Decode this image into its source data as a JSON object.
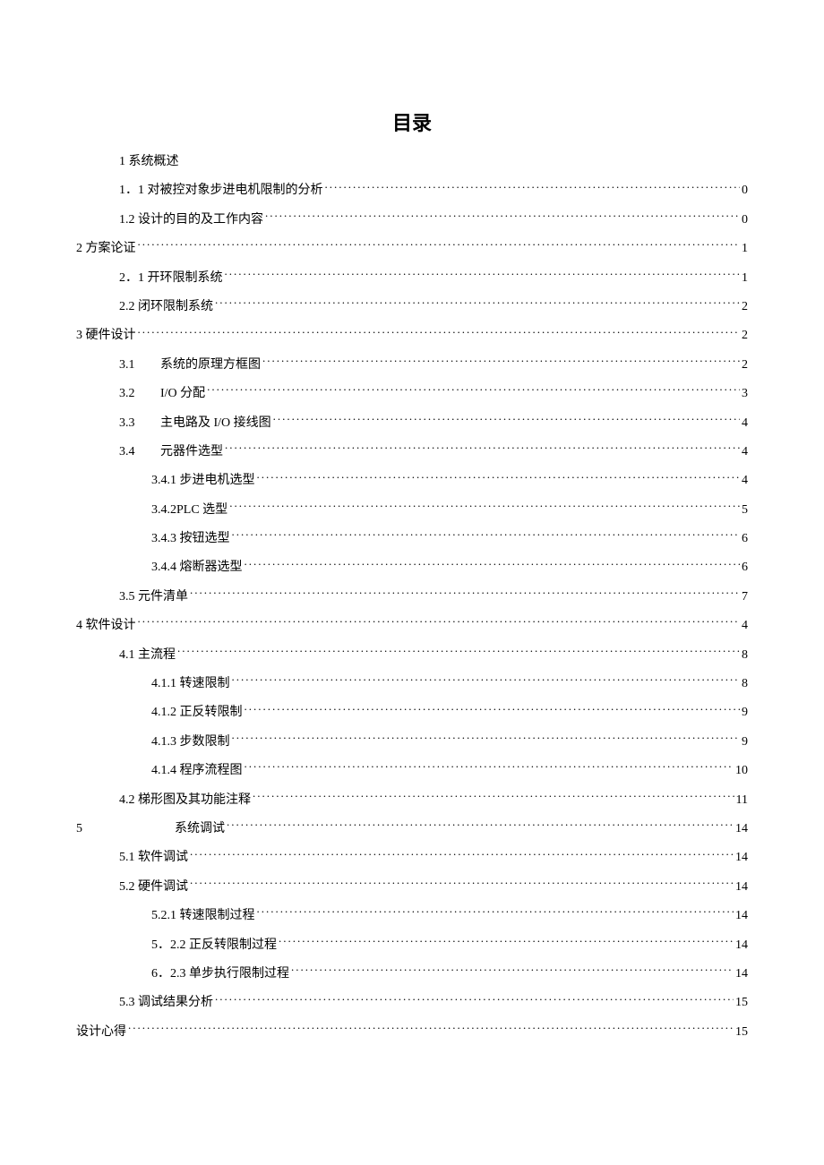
{
  "title": "目录",
  "entries": [
    {
      "indent": 1,
      "text": "1 系统概述",
      "page": "",
      "nodots": true
    },
    {
      "indent": 1,
      "text": "1．1 对被控对象步进电机限制的分析 ",
      "page": "0"
    },
    {
      "indent": 1,
      "text": "1.2 设计的目的及工作内容 ",
      "page": "0"
    },
    {
      "indent": 0,
      "text": "2 方案论证 ",
      "page": "1"
    },
    {
      "indent": 1,
      "text": "2．1 开环限制系统 ",
      "page": "1"
    },
    {
      "indent": 1,
      "text": "2.2 闭环限制系统 ",
      "page": "2"
    },
    {
      "indent": 0,
      "text": "3 硬件设计 ",
      "page": "2"
    },
    {
      "indent": 1,
      "num": "3.1",
      "text": "系统的原理方框图",
      "page": "2"
    },
    {
      "indent": 1,
      "num": "3.2",
      "text": "I/O 分配",
      "page": "3"
    },
    {
      "indent": 1,
      "num": "3.3",
      "text": "主电路及 I/O 接线图",
      "page": "4"
    },
    {
      "indent": 1,
      "num": "3.4",
      "text": "元器件选型",
      "page": "4"
    },
    {
      "indent": 2,
      "text": "3.4.1 步进电机选型 ",
      "page": "4"
    },
    {
      "indent": 2,
      "text": "3.4.2PLC 选型 ",
      "page": "5"
    },
    {
      "indent": 2,
      "text": "3.4.3 按钮选型 ",
      "page": "6"
    },
    {
      "indent": 2,
      "text": "3.4.4 熔断器选型 ",
      "page": "6"
    },
    {
      "indent": 1,
      "text": "3.5 元件清单 ",
      "page": "7"
    },
    {
      "indent": 0,
      "text": "4 软件设计 ",
      "page": "4"
    },
    {
      "indent": 1,
      "text": "4.1 主流程 ",
      "page": "8"
    },
    {
      "indent": 2,
      "text": "4.1.1 转速限制 ",
      "page": "8"
    },
    {
      "indent": 2,
      "text": "4.1.2 正反转限制 ",
      "page": "9"
    },
    {
      "indent": 2,
      "text": "4.1.3 步数限制 ",
      "page": "9"
    },
    {
      "indent": 2,
      "text": "4.1.4 程序流程图 ",
      "page": "10"
    },
    {
      "indent": 1,
      "text": "4.2 梯形图及其功能注释 ",
      "page": "11"
    },
    {
      "indent": 0,
      "num5": "5",
      "text": "系统调试",
      "page": "14"
    },
    {
      "indent": 1,
      "text": "5.1 软件调试 ",
      "page": "14"
    },
    {
      "indent": 1,
      "text": "5.2 硬件调试 ",
      "page": "14"
    },
    {
      "indent": 2,
      "text": "5.2.1 转速限制过程 ",
      "page": "14"
    },
    {
      "indent": 2,
      "text": "5．2.2 正反转限制过程 ",
      "page": "14"
    },
    {
      "indent": 2,
      "text": "6．2.3 单步执行限制过程 ",
      "page": "14"
    },
    {
      "indent": 1,
      "text": "5.3 调试结果分析 ",
      "page": "15"
    },
    {
      "indent": 0,
      "text": "设计心得",
      "page": "15"
    }
  ]
}
